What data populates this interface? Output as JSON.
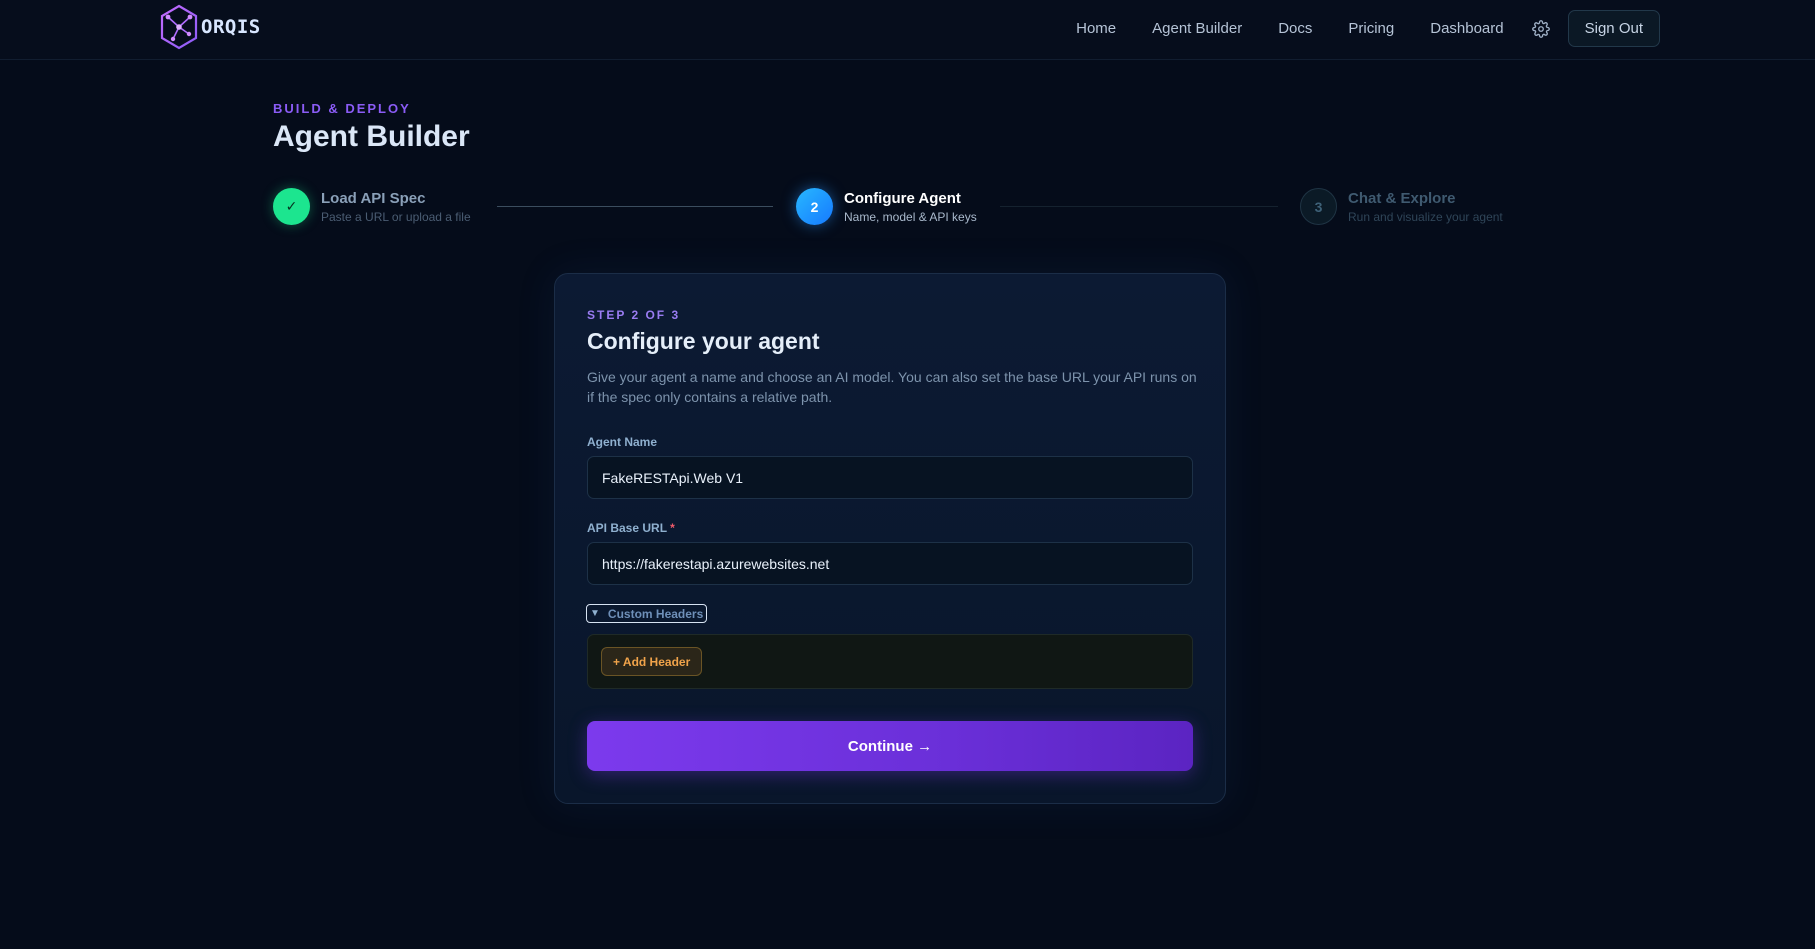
{
  "brand": {
    "name": "ORQIS",
    "accent": "#8b5cf6"
  },
  "nav": {
    "links": [
      "Home",
      "Agent Builder",
      "Docs",
      "Pricing",
      "Dashboard"
    ],
    "settings_icon": "gear-icon",
    "signout_label": "Sign Out"
  },
  "header": {
    "eyebrow": "BUILD & DEPLOY",
    "title": "Agent Builder"
  },
  "stepper": {
    "steps": [
      {
        "marker": "✓",
        "title": "Load API Spec",
        "subtitle": "Paste a URL or upload a file",
        "state": "complete"
      },
      {
        "marker": "2",
        "title": "Configure Agent",
        "subtitle": "Name, model & API keys",
        "state": "active"
      },
      {
        "marker": "3",
        "title": "Chat & Explore",
        "subtitle": "Run and visualize your agent",
        "state": "pending"
      }
    ]
  },
  "card": {
    "eyebrow": "STEP 2 OF 3",
    "title": "Configure your agent",
    "description": "Give your agent a name and choose an AI model. You can also set the base URL your API runs on if the spec only contains a relative path.",
    "agent_name": {
      "label": "Agent Name",
      "value": "FakeRESTApi.Web V1"
    },
    "base_url": {
      "label": "API Base URL",
      "required_mark": "*",
      "value": "https://fakerestapi.azurewebsites.net"
    },
    "custom_headers": {
      "arrow": "▼",
      "label": "Custom Headers",
      "add_label": "+ Add Header"
    },
    "continue_label": "Continue →"
  },
  "colors": {
    "background": "#050c1a",
    "step_complete": "#1ce58f",
    "step_active": "#1679ff",
    "primary_button": "#7c3aed",
    "add_header": "#f0a34a"
  }
}
